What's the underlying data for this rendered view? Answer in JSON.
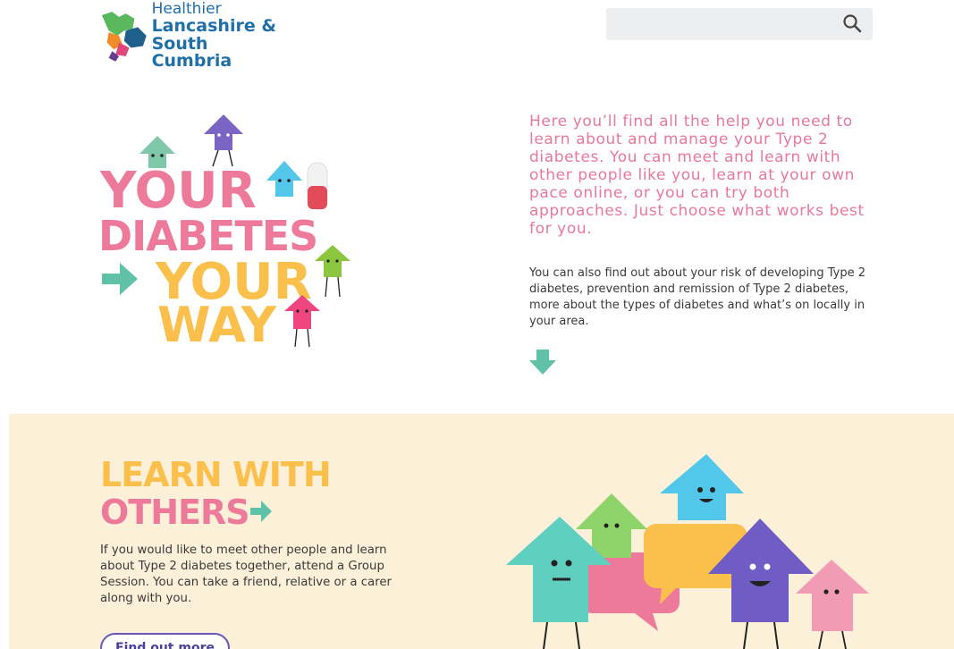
{
  "header": {
    "logo": {
      "line1": "Healthier",
      "line2": "Lancashire &",
      "line3": "South Cumbria"
    },
    "search": {
      "placeholder": "",
      "icon": "search-icon"
    }
  },
  "hero": {
    "art": {
      "line1": "YOUR",
      "line2": "DIABETES",
      "line3": "YOUR",
      "line4": "WAY"
    },
    "intro": "Here you’ll find all the help you need to learn about and manage your Type 2 diabetes. You can meet and learn with other people like you, learn at your own pace online, or you can try both approaches. Just choose what works best for you.",
    "secondary": "You can also find out about your risk of developing Type 2 diabetes, prevention and remission of Type 2 diabetes, more about the types of diabetes and what’s on locally in your area.",
    "scroll_icon": "arrow-down-icon"
  },
  "learn": {
    "heading_line1": "LEARN WITH",
    "heading_line2": "OTHERS",
    "body": "If you would like to meet other people and learn about Type 2 diabetes together, attend a Group Session. You can take a friend, relative or a carer along with you.",
    "button": "Find out more"
  },
  "colors": {
    "brand_blue": "#1f6fa8",
    "pink": "#e9789a",
    "yellow": "#fbbf4c",
    "teal": "#5fc2a6",
    "purple": "#6a57b6",
    "band": "#fdf0d9"
  }
}
